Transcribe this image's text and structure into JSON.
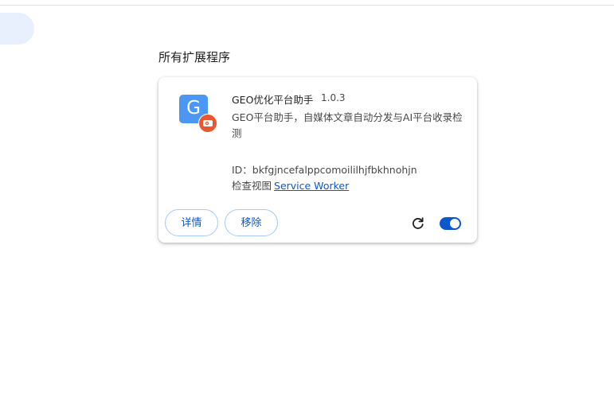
{
  "section": {
    "title": "所有扩展程序"
  },
  "extension": {
    "icon_letter": "G",
    "name": "GEO优化平台助手",
    "version": "1.0.3",
    "description": "GEO平台助手，自媒体文章自动分发与AI平台收录检测",
    "id_text": "ID：bkfgjncefalppcomoililhjfbkhnohjn",
    "views_label": "检查视图",
    "views_link": "Service Worker",
    "details_label": "详情",
    "remove_label": "移除",
    "enabled": true
  },
  "colors": {
    "accent": "#0b57d0",
    "icon_bg": "#4b97f3",
    "badge_bg": "#e8572f",
    "side_pill": "#e8effd"
  },
  "icons": {
    "reload": "reload-icon",
    "badge": "camera-badge-icon"
  }
}
